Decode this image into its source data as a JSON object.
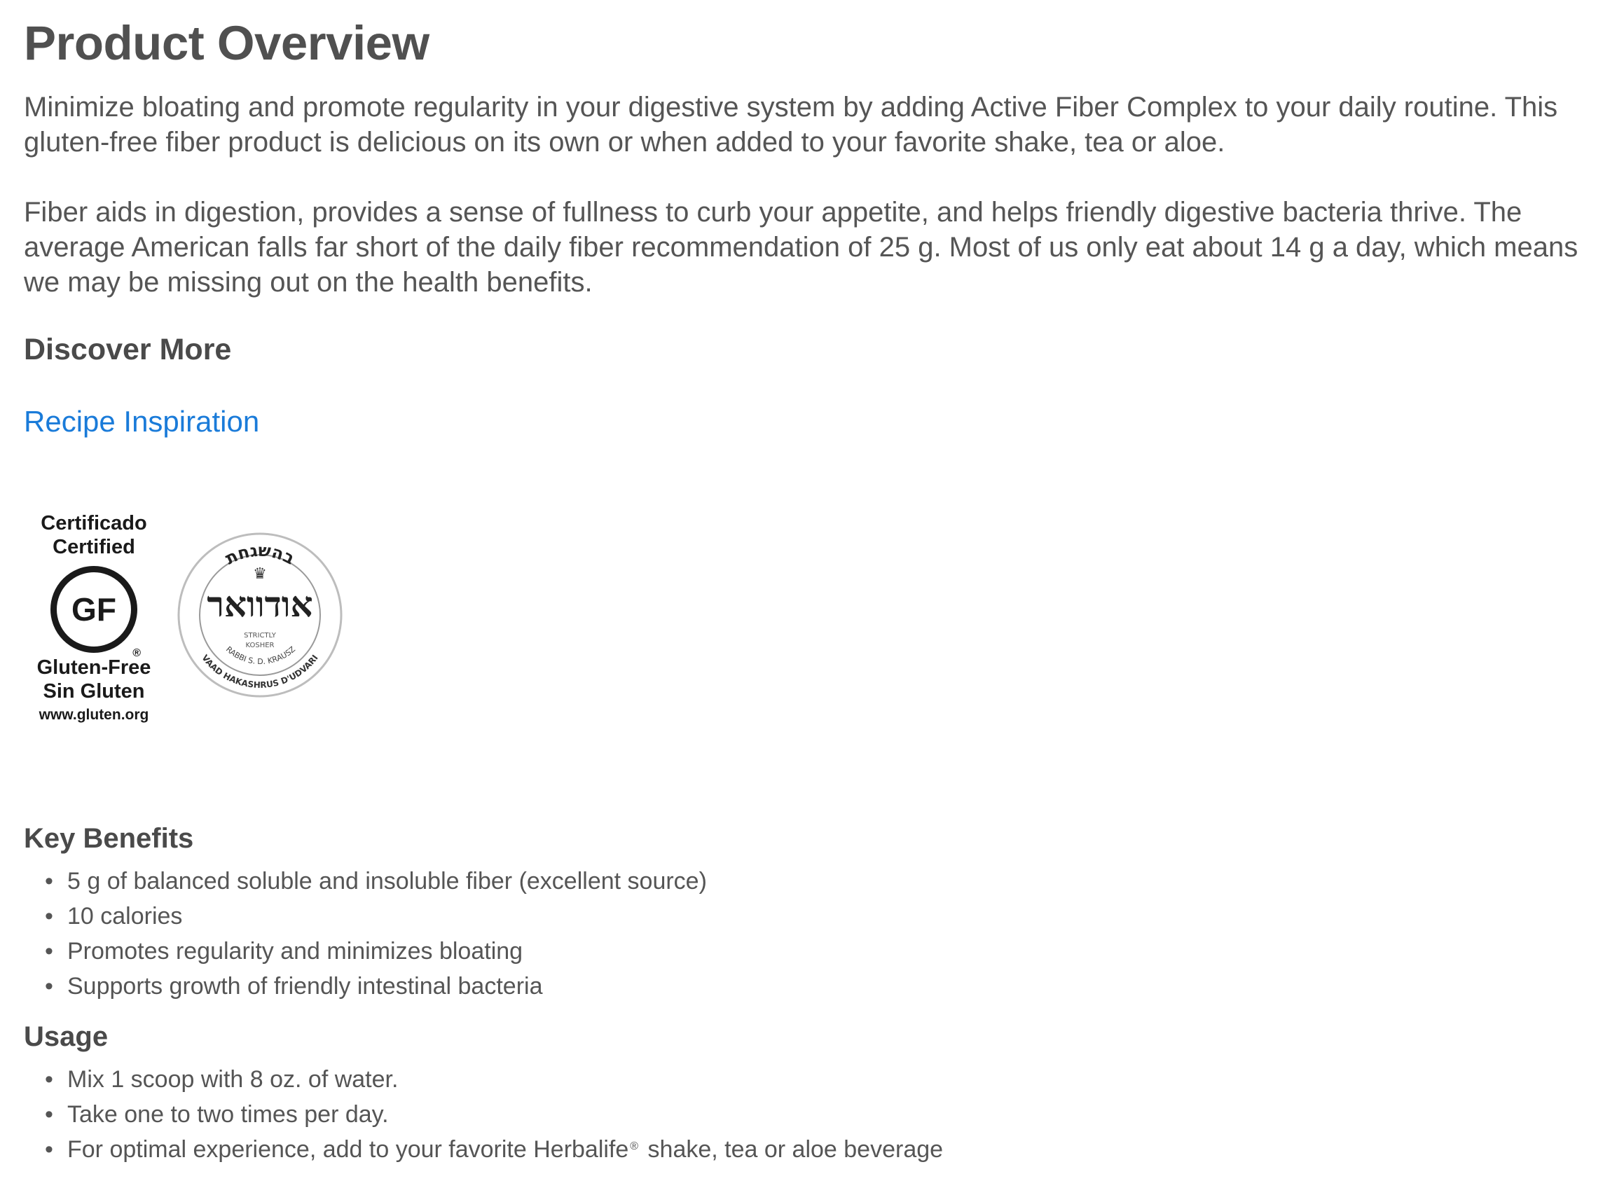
{
  "overview": {
    "title": "Product Overview",
    "paragraph1": "Minimize bloating and promote regularity in your digestive system by adding Active Fiber Complex to your daily routine. This gluten-free fiber product is delicious on its own or when added to your favorite shake, tea or aloe.",
    "paragraph2": "Fiber aids in digestion, provides a sense of fullness to curb your appetite, and helps friendly digestive bacteria thrive. The average American falls far short of the daily fiber recommendation of 25 g. Most of us only eat about 14 g a day, which means we may be missing out on the health benefits."
  },
  "discover": {
    "heading": "Discover More",
    "link_label": "Recipe Inspiration",
    "link_color": "#1a7bd9"
  },
  "badges": {
    "gluten_free": {
      "line1": "Certificado",
      "line2": "Certified",
      "circle_text": "GF",
      "registered": "®",
      "line3": "Gluten-Free",
      "line4": "Sin Gluten",
      "url": "www.gluten.org"
    },
    "kosher": {
      "top_arc": "בהשגחת",
      "hebrew_main": "אודוואר",
      "strictly": "STRICTLY",
      "kosher": "KOSHER",
      "rabbi": "RABBI S. D. KRAUSZ",
      "vaad": "VAAD HAKASHRUS D'UDVARI"
    }
  },
  "key_benefits": {
    "heading": "Key Benefits",
    "items": [
      "5 g of balanced soluble and insoluble fiber (excellent source)",
      "10 calories",
      "Promotes regularity and minimizes bloating",
      "Supports growth of friendly intestinal bacteria"
    ]
  },
  "usage": {
    "heading": "Usage",
    "items": [
      "Mix 1 scoop with 8 oz. of water.",
      "Take one to two times per day."
    ],
    "item3_before": "For optimal experience, add to your favorite Herbalife",
    "item3_mark": "®",
    "item3_after": " shake, tea or aloe beverage"
  },
  "bullet_char": "•"
}
